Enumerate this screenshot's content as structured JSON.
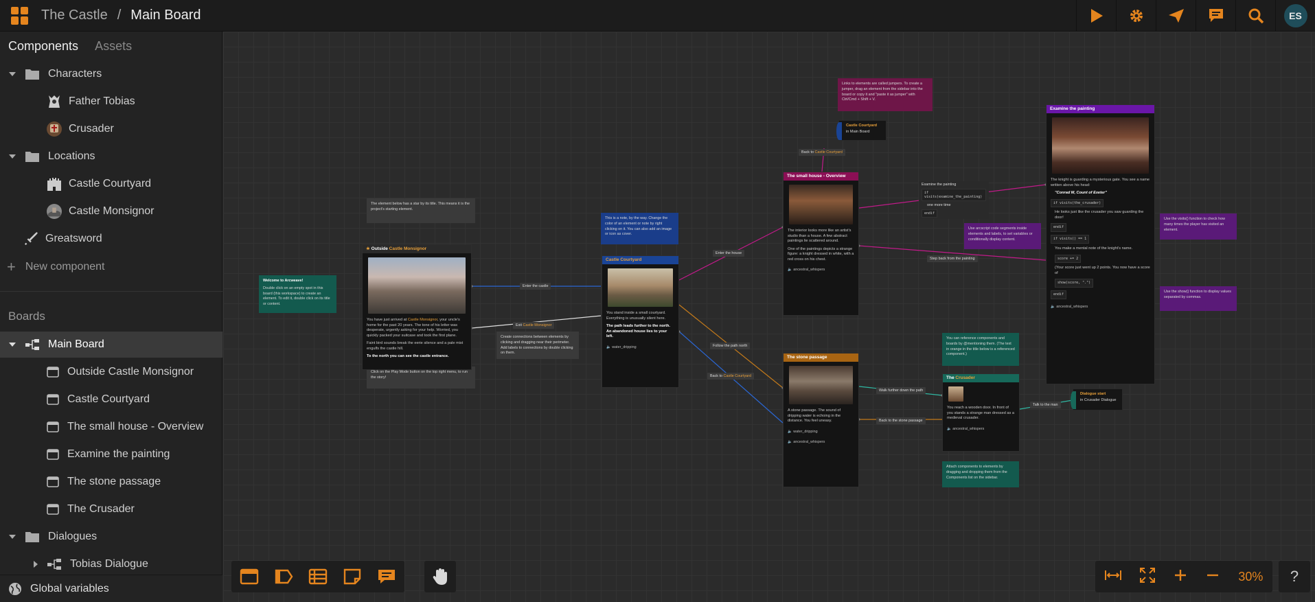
{
  "header": {
    "project": "The Castle",
    "separator": "/",
    "board": "Main Board",
    "avatar_initials": "ES",
    "accent": "#e5851e"
  },
  "sidebar": {
    "tabs": [
      "Components",
      "Assets"
    ],
    "components": [
      {
        "label": "Characters",
        "type": "folder"
      },
      {
        "label": "Father Tobias",
        "type": "character"
      },
      {
        "label": "Crusader",
        "type": "character"
      },
      {
        "label": "Locations",
        "type": "folder"
      },
      {
        "label": "Castle Courtyard",
        "type": "location"
      },
      {
        "label": "Castle Monsignor",
        "type": "location"
      },
      {
        "label": "Greatsword",
        "type": "item"
      }
    ],
    "new_component": "New component",
    "boards_label": "Boards",
    "boards": [
      {
        "label": "Main Board",
        "type": "board"
      },
      {
        "label": "Outside Castle Monsignor",
        "type": "element"
      },
      {
        "label": "Castle Courtyard",
        "type": "element"
      },
      {
        "label": "The small house - Overview",
        "type": "element"
      },
      {
        "label": "Examine the painting",
        "type": "element"
      },
      {
        "label": "The stone passage",
        "type": "element"
      },
      {
        "label": "The Crusader",
        "type": "element"
      },
      {
        "label": "Dialogues",
        "type": "folder"
      },
      {
        "label": "Tobias Dialogue",
        "type": "board"
      }
    ],
    "global_variables": "Global variables"
  },
  "canvas": {
    "notes": {
      "welcome": {
        "title": "Welcome to Arcweave!",
        "body": "Double click on an empty spot in this board (this workspace) to create an element. To edit it, double click on its title or content."
      },
      "start": {
        "body": "The element below has a star by its title. This means it is the project's starting element."
      },
      "play": {
        "body": "Click on the Play Mode button on the top right menu, to run the story!"
      },
      "note_color": {
        "body": "This is a note, by the way. Change the color of an element or note by right clicking on it. You can also add an image or icon as cover."
      },
      "connections": {
        "body": "Create connections between elements by clicking and dragging near their perimeter. Add labels to connections by double clicking on them."
      },
      "jumpers": {
        "body": "Links to elements are called jumpers. To create a jumper, drag an element from the sidebar into the board or copy it and \"paste it as jumper\" with Ctrl/Cmd + Shift + V."
      },
      "arcscript": {
        "body": "Use arcscript code segments inside elements and labels, to set variables or conditionally display content."
      },
      "visits": {
        "body": "Use the visits() function to check how many times the player has visited an element."
      },
      "show": {
        "body": "Use the show() function to display values separated by commas."
      },
      "reference": {
        "body": "You can reference components and boards by @mentioning them. (The text in orange in the title below is a referenced component.)"
      },
      "attach": {
        "body": "Attach components to elements by dragging and dropping them from the Components list on the sidebar."
      }
    },
    "elements": {
      "outside": {
        "title_prefix": "Outside",
        "title_ref": "Castle Monsignor",
        "p1_a": "You have just arrived at",
        "p1_ref": "Castle Monsignor",
        "p1_b": ", your uncle's home for the past 20 years. The tone of his letter was desperate, urgently asking for your help. Worried, you quickly packed your suitcase and took the first plane.",
        "p2": "Faint bird sounds break the eerie silence and a pale mist engulfs the castle hill.",
        "p3": "To the north you can see the castle entrance."
      },
      "courtyard": {
        "title": "Castle Courtyard",
        "p1": "You stand inside a small courtyard. Everything is unusually silent here.",
        "p2": "The path leads further to the north. An abandoned house lies to your left.",
        "audio": "water_dripping"
      },
      "smallhouse": {
        "title": "The small house - Overview",
        "p1": "The interior looks more like an artist's studio than a house. A few abstract paintings lie scattered around.",
        "p2": "One of the paintings depicts a strange figure: a knight dressed in white, with a red cross on his chest.",
        "audio": "ancestral_whispers"
      },
      "painting": {
        "title": "Examine the painting",
        "p1": "The knight is guarding a mysterious gate. You see a name written above his head:",
        "quote": "\"Conrad M, Count of Exeter\"",
        "c1": "if visits(the_crusader)",
        "p2": "He looks just like the crusader you saw guarding the door!",
        "c2": "endif",
        "c3": "if visits() == 1",
        "p3": "You make a mental note of the knight's name.",
        "c4": "score += 2",
        "p4": "(Your score just went up 2 points. You now have a score of",
        "c5": "show(score, \".\")",
        "c6": "endif",
        "audio": "ancestral_whispers"
      },
      "stone": {
        "title": "The stone passage",
        "p1": "A stone passage. The sound of dripping water is echoing in the distance. You feel uneasy.",
        "audio1": "water_dripping",
        "audio2": "ancestral_whispers"
      },
      "crusader": {
        "title_prefix": "The",
        "title_ref": "Crusader",
        "p1": "You reach a wooden door. In front of you stands a strange man dressed as a medieval crusader.",
        "audio": "ancestral_whispers"
      }
    },
    "jumpers": {
      "j1": {
        "title": "Castle Courtyard",
        "sub": "in Main Board"
      },
      "j2": {
        "title": "Dialogue start",
        "sub": "in Crusader Dialogue"
      }
    },
    "labels": {
      "enter_castle": "Enter the castle",
      "exit_prefix": "Exit",
      "exit_ref": "Castle Monsignor",
      "enter_house": "Enter the house",
      "follow_path": "Follow the path north",
      "back_prefix": "Back to",
      "back_ref": "Castle Courtyard",
      "back2_prefix": "Back to",
      "back2_ref": "Castle Courtyard",
      "examine": "Examine the painting",
      "examine_code": "if visits(examine_the_painting)",
      "examine_once": "one more time",
      "examine_end": "endif",
      "step_back": "Step back from the painting",
      "walk_further": "Walk further down the path",
      "back_stone": "Back to the stone passage",
      "talk": "Talk to the man"
    }
  },
  "toolbar": {
    "zoom": "30%",
    "help": "?"
  },
  "colors": {
    "accent": "#e5851e",
    "note_teal": "#135a4e",
    "note_blue": "#1a3d8a",
    "note_purple": "#5a1a78",
    "note_magenta": "#6e1648",
    "note_gray": "#3a3a3a",
    "head_blue": "#1a4496",
    "head_magenta": "#8b0f55",
    "head_purple": "#6a16a8",
    "head_amber": "#a86412",
    "head_teal": "#17695a"
  }
}
